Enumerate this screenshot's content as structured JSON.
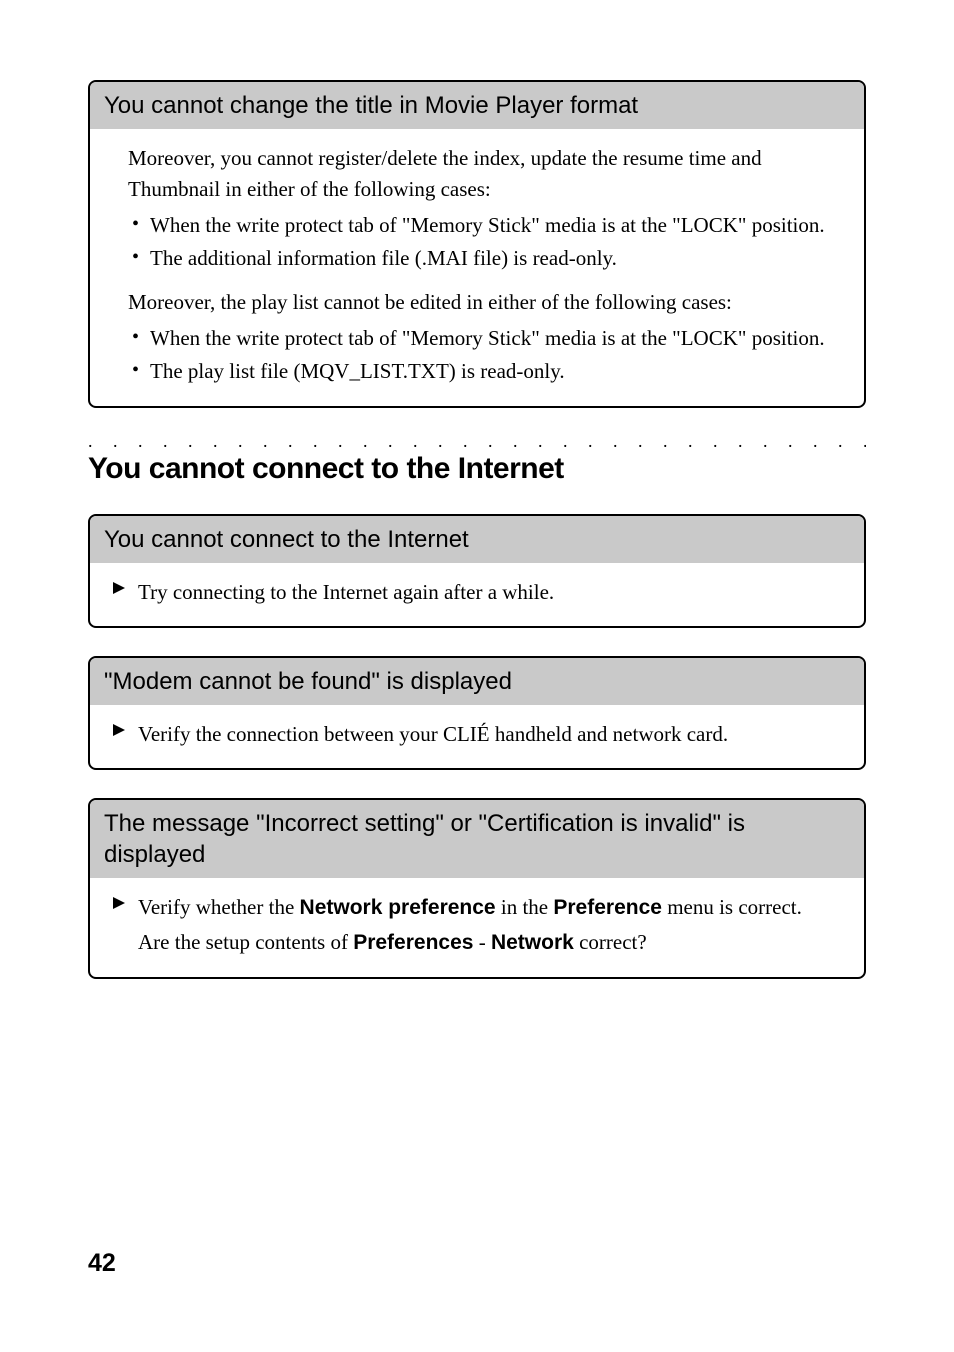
{
  "box1": {
    "header": "You cannot change the title in Movie Player format",
    "intro1": "Moreover, you cannot register/delete the index, update the resume time and Thumbnail in either of the following cases:",
    "list1": [
      "When the write protect tab of \"Memory Stick\" media is at the \"LOCK\" position.",
      "The additional information file (.MAI file) is read-only."
    ],
    "intro2": "Moreover, the play list cannot be edited in either of the following cases:",
    "list2": [
      "When the write protect tab of \"Memory Stick\" media is at the \"LOCK\" position.",
      "The play list file (MQV_LIST.TXT) is read-only."
    ]
  },
  "section_heading": "You cannot connect to the Internet",
  "box2": {
    "header": "You cannot connect to the Internet",
    "item": "Try connecting to the Internet again after a while."
  },
  "box3": {
    "header": "\"Modem cannot be found\" is displayed",
    "item": "Verify the connection between your CLIÉ handheld and network card."
  },
  "box4": {
    "header": "The message \"Incorrect setting\" or \"Certification is invalid\" is displayed",
    "line1_pre": "Verify whether the ",
    "line1_bold1": "Network preference",
    "line1_mid": " in the ",
    "line1_bold2": "Preference",
    "line1_post": " menu is correct.",
    "line2_pre": "Are the setup contents of ",
    "line2_bold1": "Preferences",
    "line2_sep": " - ",
    "line2_bold2": "Network",
    "line2_post": " correct?"
  },
  "page_number": "42"
}
